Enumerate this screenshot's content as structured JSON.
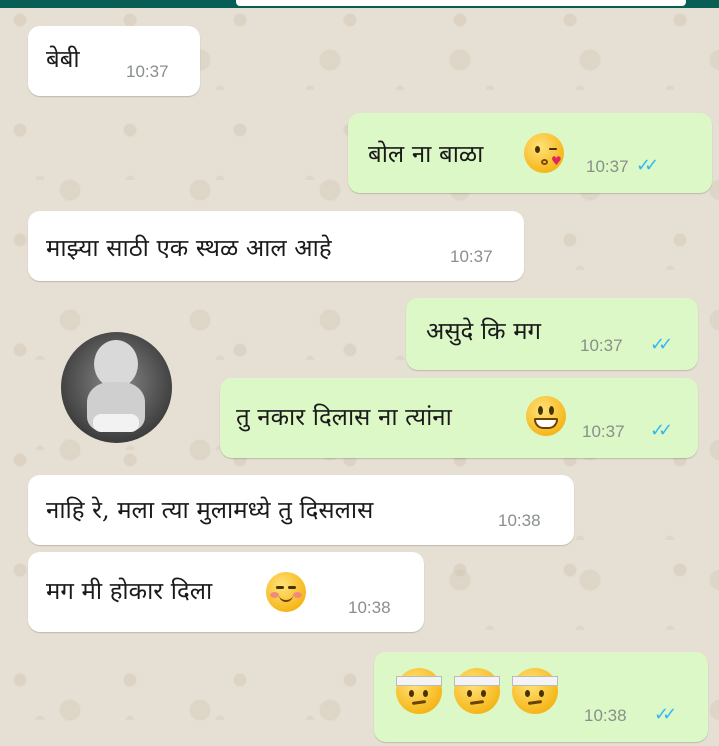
{
  "messages": [
    {
      "text": "बेबी",
      "time": "10:37",
      "direction": "incoming"
    },
    {
      "text": "बोल ना बाळा",
      "emoji": "kissing-wink-emoji",
      "time": "10:37",
      "direction": "outgoing",
      "read_ticks": "✓✓"
    },
    {
      "text": "माझ्या साठी एक स्थळ आल आहे",
      "time": "10:37",
      "direction": "incoming"
    },
    {
      "text": "असुदे कि मग",
      "time": "10:37",
      "direction": "outgoing",
      "read_ticks": "✓✓"
    },
    {
      "text": "तु नकार दिलास ना त्यांना",
      "emoji": "grinning-emoji",
      "time": "10:37",
      "direction": "outgoing",
      "read_ticks": "✓✓"
    },
    {
      "text": "नाहि रे, मला त्या मुलामध्ये तु दिसलास",
      "time": "10:38",
      "direction": "incoming"
    },
    {
      "text": "मग मी होकार दिला",
      "emoji": "blushing-smile-emoji",
      "time": "10:38",
      "direction": "incoming"
    },
    {
      "emojis": [
        "bandaged-face-emoji",
        "bandaged-face-emoji",
        "bandaged-face-emoji"
      ],
      "time": "10:38",
      "direction": "outgoing",
      "read_ticks": "✓✓"
    }
  ],
  "avatar": {
    "description_icon": "baby-photo-avatar"
  },
  "colors": {
    "incoming_bubble": "#ffffff",
    "outgoing_bubble": "#dcf8c6",
    "read_tick": "#34b7f1",
    "header": "#075e54",
    "wallpaper": "#e6dfd3"
  }
}
